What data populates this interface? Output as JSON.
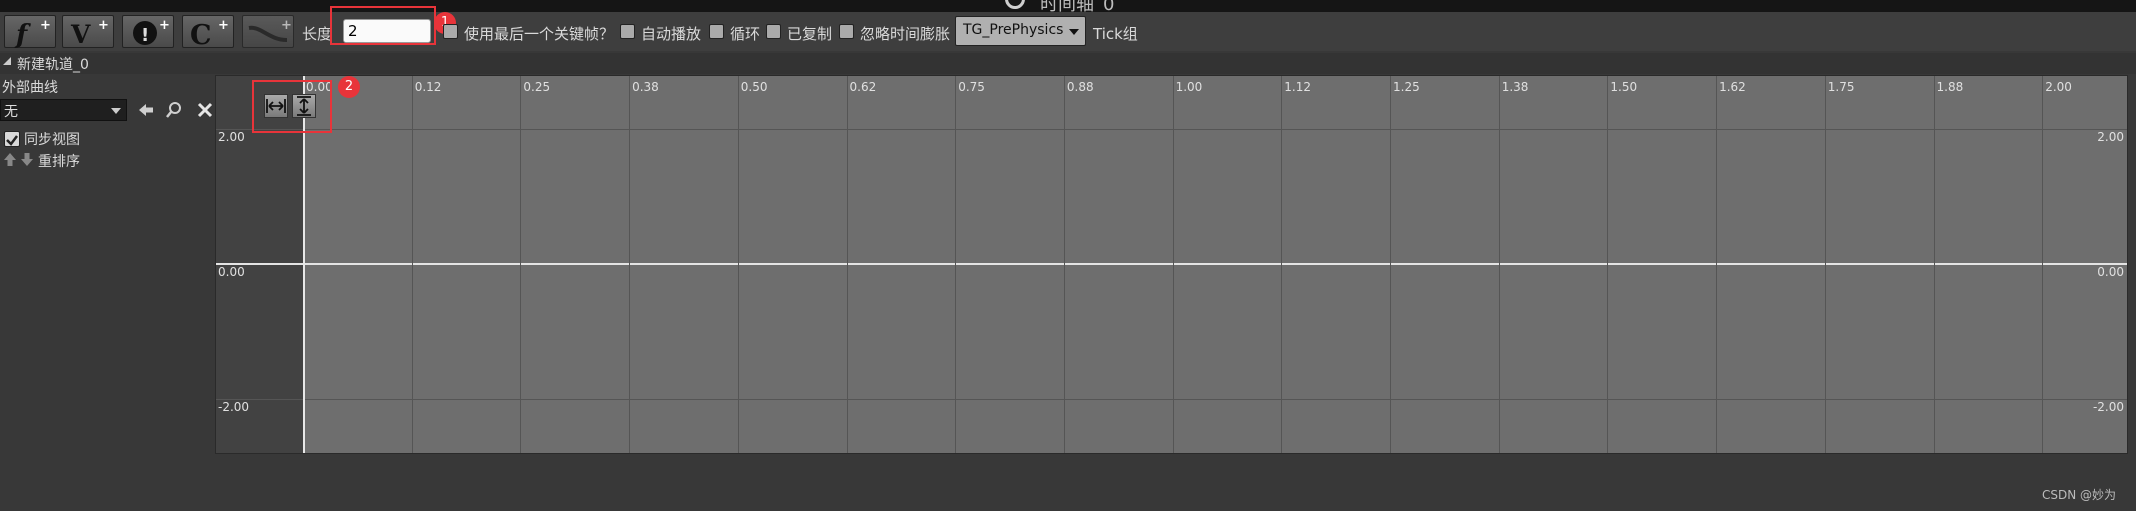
{
  "window": {
    "title": "时间轴_0"
  },
  "toolbar": {
    "buttons": [
      {
        "name": "add-float-track",
        "glyph": "f"
      },
      {
        "name": "add-vector-track",
        "glyph": "V"
      },
      {
        "name": "add-event-track",
        "glyph": "!"
      },
      {
        "name": "add-color-track",
        "glyph": "C"
      },
      {
        "name": "add-curve-asset",
        "glyph": "~"
      }
    ],
    "length_label": "长度",
    "length_value": "2",
    "use_last_keyframe_label": "使用最后一个关键帧？",
    "autoplay_label": "自动播放",
    "loop_label": "循环",
    "replicated_label": "已复制",
    "ignore_dilation_label": "忽略时间膨胀",
    "tick_group_value": "TG_PrePhysics",
    "tick_group_label": "Tick组"
  },
  "annotations": {
    "badge1": "1",
    "badge2": "2"
  },
  "track": {
    "name": "新建轨道_0",
    "external_curve_label": "外部曲线",
    "external_curve_value": "无",
    "sync_view_label": "同步视图",
    "sync_view_checked": true,
    "reorder_label": "重排序"
  },
  "graph": {
    "x_ticks": [
      "0.00",
      "0.12",
      "0.25",
      "0.38",
      "0.50",
      "0.62",
      "0.75",
      "0.88",
      "1.00",
      "1.12",
      "1.25",
      "1.38",
      "1.50",
      "1.62",
      "1.75",
      "1.88",
      "2.00"
    ],
    "y_labels": {
      "top": "2.00",
      "mid": "0.00",
      "bottom": "-2.00"
    }
  },
  "footer": {
    "watermark": "CSDN @妙为"
  },
  "colors": {
    "annotation": "#e8343a",
    "graph_bg": "#6e6e6e",
    "panel_bg": "#383838"
  }
}
